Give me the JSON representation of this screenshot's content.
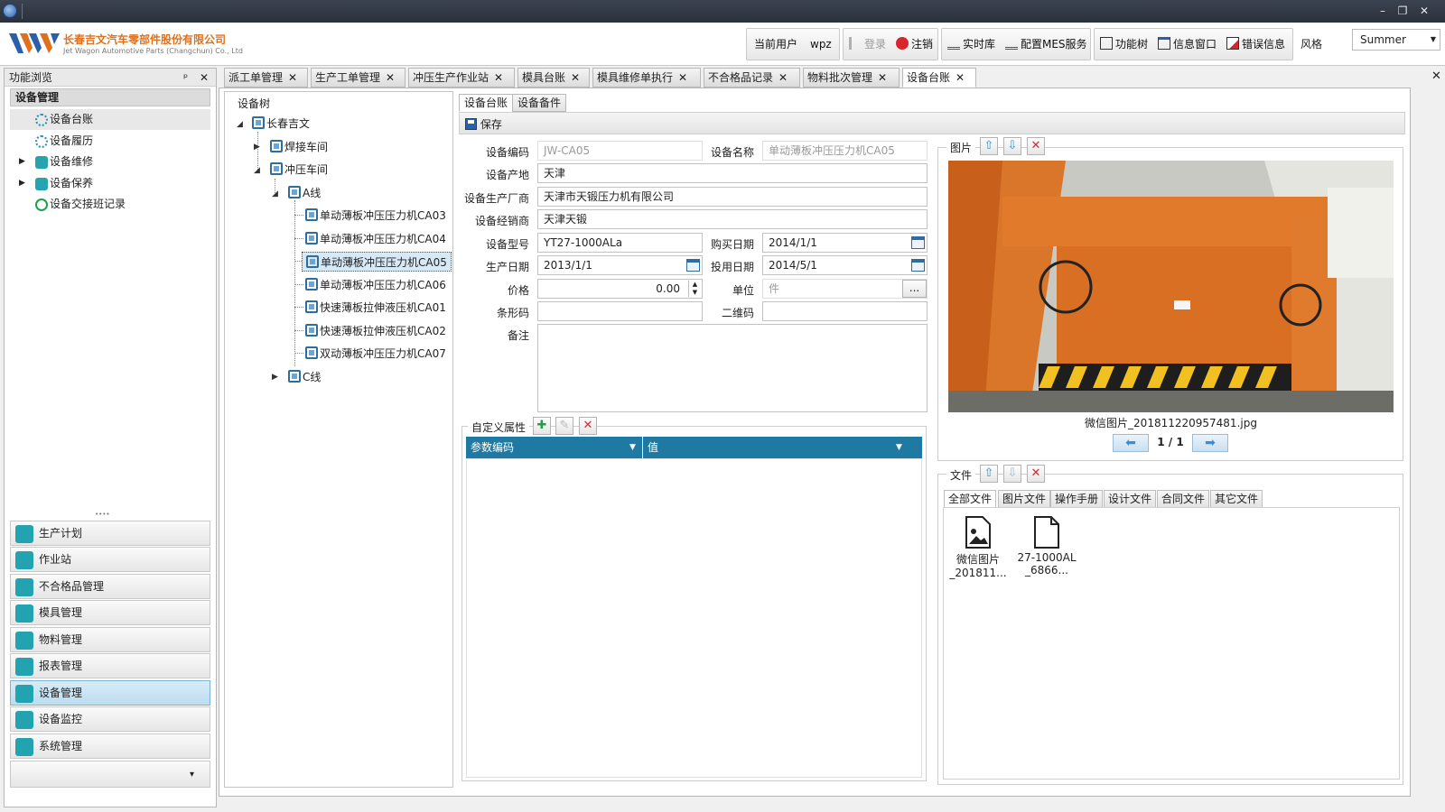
{
  "window": {
    "minimize_glyph": "–",
    "restore_glyph": "❐",
    "close_glyph": "✕"
  },
  "brand": {
    "name_cn": "长春吉文汽车零部件股份有限公司",
    "name_en": "Jet Wagon Automotive Parts (Changchun) Co., Ltd",
    "accent": "#e0711c"
  },
  "toolbar": {
    "current_user_label": "当前用户",
    "current_user_value": "wpz",
    "login": "登录",
    "logout": "注销",
    "realtime_db": "实时库",
    "configure_mes": "配置MES服务",
    "function_tree": "功能树",
    "info_window": "信息窗口",
    "error_info": "错误信息",
    "style_label": "风格",
    "style_value": "Summer"
  },
  "left_panel": {
    "title": "功能浏览",
    "pin": "ᵖ",
    "close": "✕",
    "section": "设备管理",
    "items": [
      {
        "label": "设备台账"
      },
      {
        "label": "设备履历"
      },
      {
        "label": "设备维修"
      },
      {
        "label": "设备保养"
      },
      {
        "label": "设备交接班记录"
      }
    ],
    "splitter": "••••",
    "modules": [
      {
        "label": "生产计划"
      },
      {
        "label": "作业站"
      },
      {
        "label": "不合格品管理"
      },
      {
        "label": "模具管理"
      },
      {
        "label": "物料管理"
      },
      {
        "label": "报表管理"
      },
      {
        "label": "设备管理"
      },
      {
        "label": "设备监控"
      },
      {
        "label": "系统管理"
      }
    ],
    "more": "▾"
  },
  "doc_tabs": [
    {
      "label": "派工单管理"
    },
    {
      "label": "生产工单管理"
    },
    {
      "label": "冲压生产作业站"
    },
    {
      "label": "模具台账"
    },
    {
      "label": "模具维修单执行"
    },
    {
      "label": "不合格品记录"
    },
    {
      "label": "物料批次管理"
    },
    {
      "label": "设备台账"
    }
  ],
  "doc_tabs_close_all": "✕",
  "tree": {
    "title": "设备树",
    "root": "长春吉文",
    "workshop1": "焊接车间",
    "workshop2": "冲压车间",
    "line_a": "A线",
    "machines": [
      "单动薄板冲压压力机CA03",
      "单动薄板冲压压力机CA04",
      "单动薄板冲压压力机CA05",
      "单动薄板冲压压力机CA06",
      "快速薄板拉伸液压机CA01",
      "快速薄板拉伸液压机CA02",
      "双动薄板冲压压力机CA07"
    ],
    "line_c": "C线"
  },
  "subtabs": {
    "ledger": "设备台账",
    "spare": "设备备件"
  },
  "save_label": "保存",
  "form": {
    "code_label": "设备编码",
    "code_value": "JW-CA05",
    "name_label": "设备名称",
    "name_value": "单动薄板冲压压力机CA05",
    "origin_label": "设备产地",
    "origin_value": "天津",
    "maker_label": "设备生产厂商",
    "maker_value": "天津市天锻压力机有限公司",
    "dealer_label": "设备经销商",
    "dealer_value": "天津天锻",
    "model_label": "设备型号",
    "model_value": "YT27-1000ALa",
    "buy_label": "购买日期",
    "buy_value": "2014/1/1",
    "prod_label": "生产日期",
    "prod_value": "2013/1/1",
    "use_label": "投用日期",
    "use_value": "2014/5/1",
    "price_label": "价格",
    "price_value": "0.00",
    "unit_label": "单位",
    "unit_value": "件",
    "unit_btn": "...",
    "barcode_label": "条形码",
    "qrcode_label": "二维码",
    "remark_label": "备注"
  },
  "custom_attr": {
    "title": "自定义属性",
    "col_code": "参数编码",
    "col_value": "值"
  },
  "picture": {
    "title": "图片",
    "filename": "微信图片_201811220957481.jpg",
    "page": "1 / 1"
  },
  "files": {
    "title": "文件",
    "tabs": [
      "全部文件",
      "图片文件",
      "操作手册",
      "设计文件",
      "合同文件",
      "其它文件"
    ],
    "items": [
      {
        "line1": "微信图片",
        "line2": "_201811..."
      },
      {
        "line1": "27-1000AL",
        "line2": "_6866..."
      }
    ]
  }
}
